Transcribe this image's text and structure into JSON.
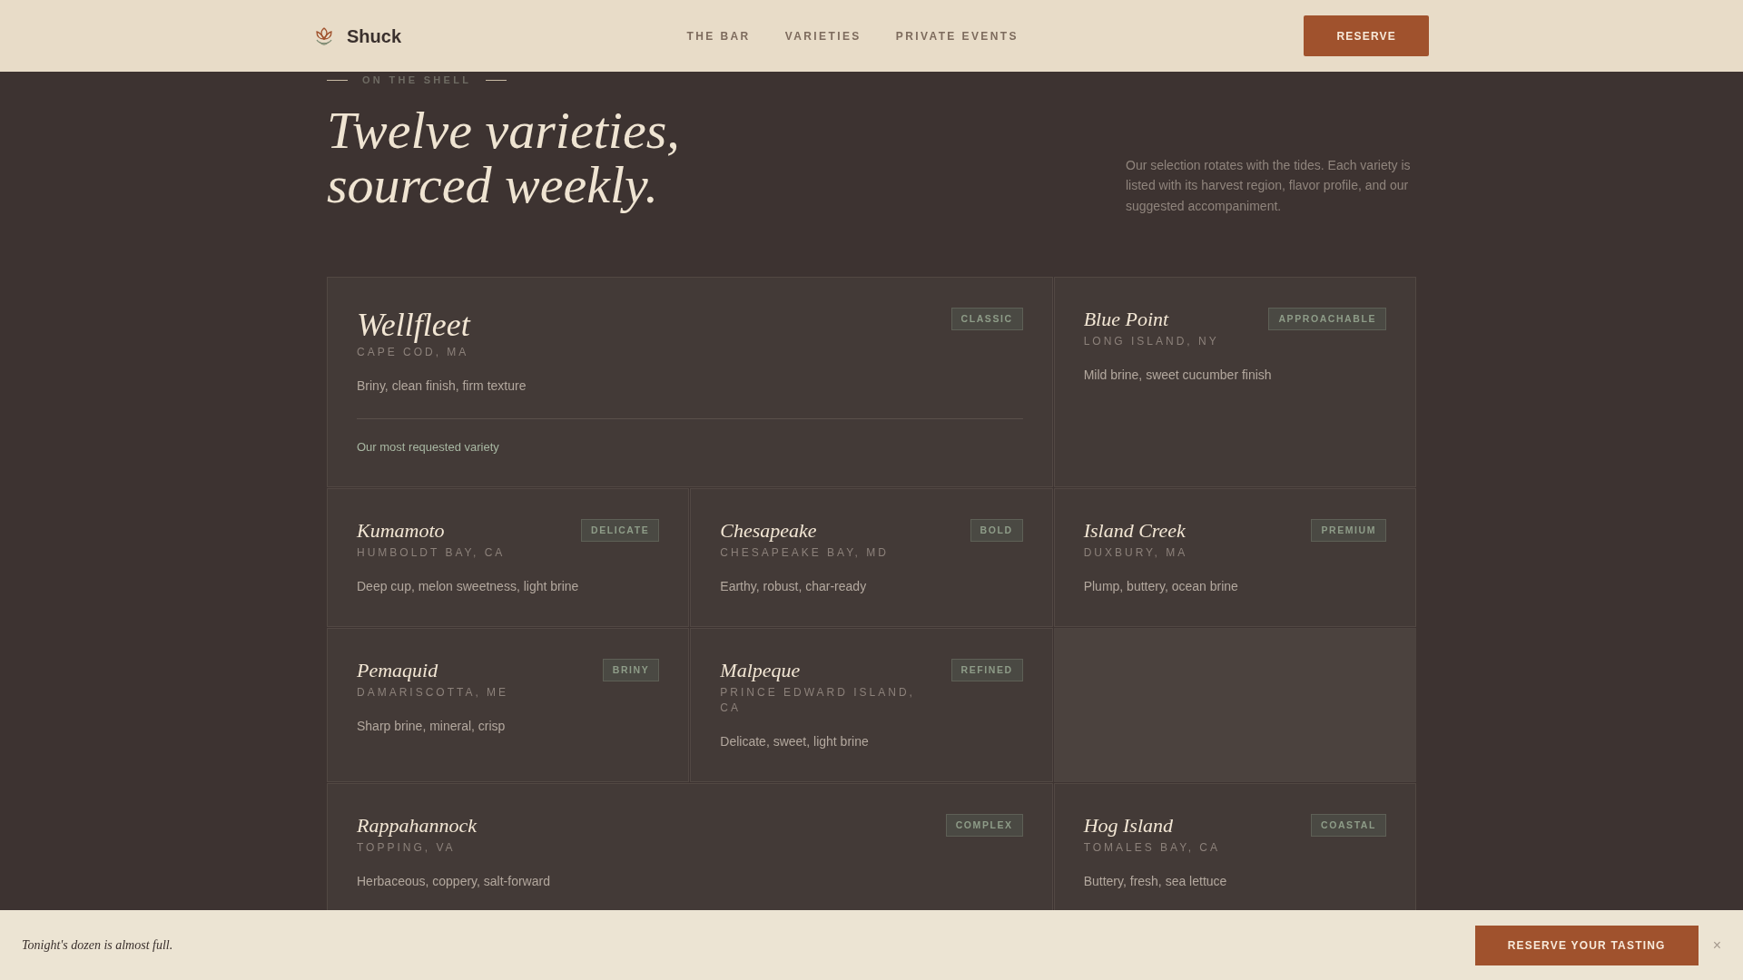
{
  "header": {
    "brand": "Shuck",
    "nav": [
      {
        "label": "THE BAR"
      },
      {
        "label": "VARIETIES"
      },
      {
        "label": "PRIVATE EVENTS"
      }
    ],
    "cta": "RESERVE"
  },
  "hero": {
    "eyebrow": "ON THE SHELL",
    "title_lines": [
      "Twelve varieties,",
      "sourced weekly."
    ],
    "intro": "Our selection rotates with the tides. Each variety is listed with its harvest region, flavor profile, and our suggested accompaniment."
  },
  "varieties": [
    {
      "kind": "featured",
      "name": "Wellfleet",
      "region": "CAPE COD, MA",
      "badge": "CLASSIC",
      "notes": "Briny, clean finish, firm texture",
      "highlight": "Our most requested variety"
    },
    {
      "kind": "standard",
      "name": "Blue Point",
      "region": "LONG ISLAND, NY",
      "badge": "APPROACHABLE",
      "notes": "Mild brine, sweet cucumber finish"
    },
    {
      "kind": "standard",
      "name": "Kumamoto",
      "region": "HUMBOLDT BAY, CA",
      "badge": "DELICATE",
      "notes": "Deep cup, melon sweetness, light brine"
    },
    {
      "kind": "standard",
      "name": "Chesapeake",
      "region": "CHESAPEAKE BAY, MD",
      "badge": "BOLD",
      "notes": "Earthy, robust, char-ready"
    },
    {
      "kind": "standard",
      "name": "Island Creek",
      "region": "DUXBURY, MA",
      "badge": "PREMIUM",
      "notes": "Plump, buttery, ocean brine"
    },
    {
      "kind": "standard",
      "name": "Pemaquid",
      "region": "DAMARISCOTTA, ME",
      "badge": "BRINY",
      "notes": "Sharp brine, mineral, crisp"
    },
    {
      "kind": "standard",
      "name": "Malpeque",
      "region": "PRINCE EDWARD ISLAND, CA",
      "badge": "REFINED",
      "notes": "Delicate, sweet, light brine"
    },
    {
      "kind": "empty"
    },
    {
      "kind": "wide",
      "name": "Rappahannock",
      "region": "TOPPING, VA",
      "badge": "COMPLEX",
      "notes": "Herbaceous, coppery, salt-forward"
    },
    {
      "kind": "standard",
      "name": "Hog Island",
      "region": "TOMALES BAY, CA",
      "badge": "COASTAL",
      "notes": "Buttery, fresh, sea lettuce"
    }
  ],
  "banner": {
    "message": "Tonight's dozen is almost full.",
    "button": "RESERVE YOUR TASTING",
    "close": "×"
  }
}
